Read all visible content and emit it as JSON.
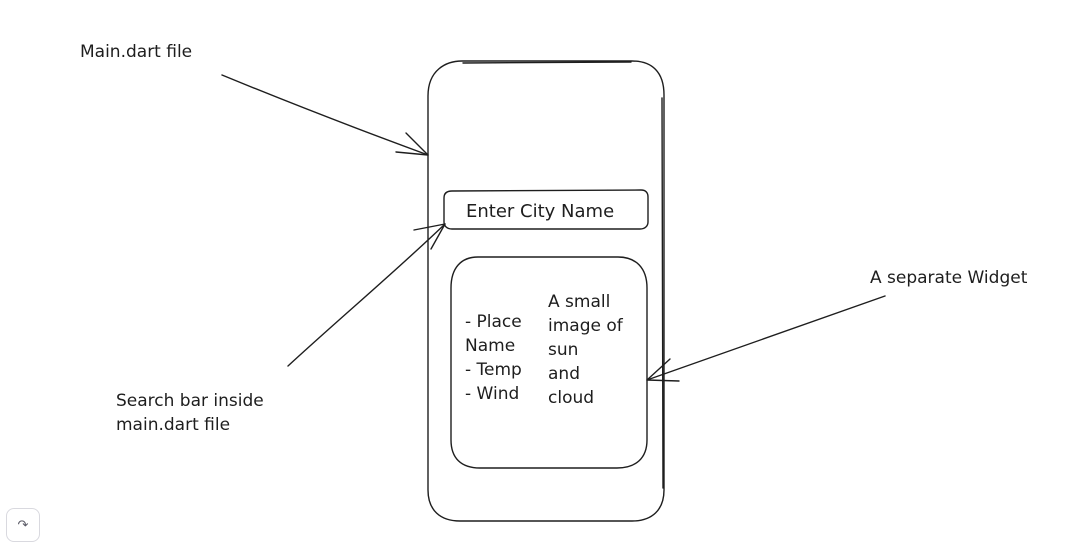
{
  "annotations": {
    "main_file": "Main.dart file",
    "search_bar_note": [
      "Search bar inside",
      "main.dart file"
    ],
    "widget_note": "A separate Widget"
  },
  "phone": {
    "search_input_placeholder": "Enter City Name",
    "card": {
      "details": [
        "- Place",
        "Name",
        "- Temp",
        "- Wind"
      ],
      "image_note": [
        "A small",
        "image of",
        "sun",
        "and",
        "cloud"
      ]
    }
  },
  "toolbar": {
    "redo_icon": "redo-icon"
  }
}
